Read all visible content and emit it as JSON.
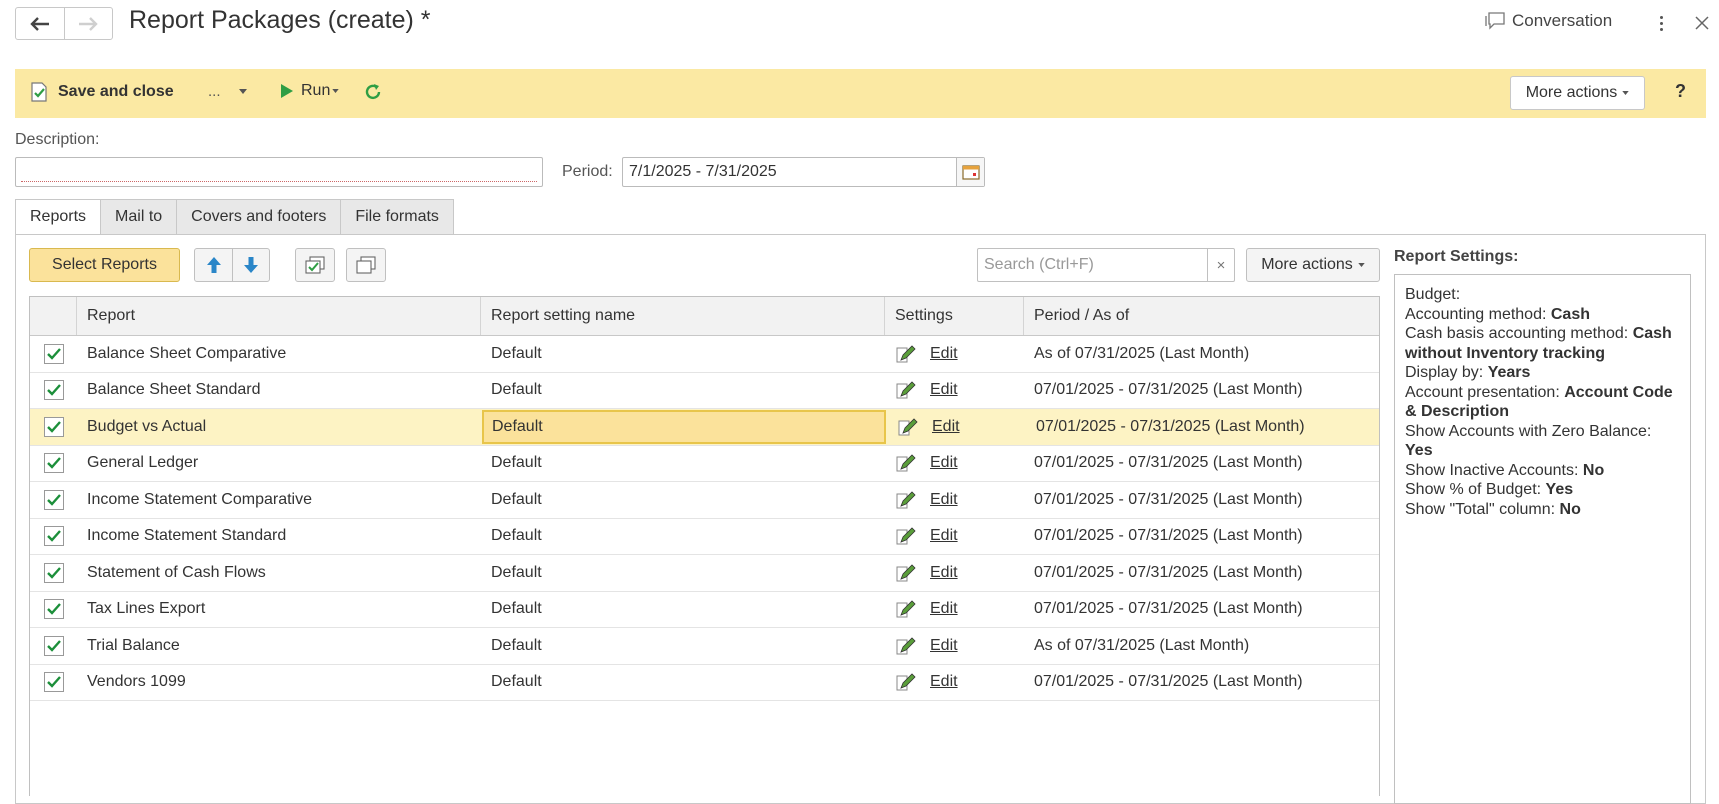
{
  "window": {
    "title": "Report Packages (create) *",
    "conversation_label": "Conversation"
  },
  "toolbar": {
    "save_close_label": "Save and close",
    "more_dd_label": "...",
    "run_label": "Run",
    "more_actions_label": "More actions",
    "help_label": "?"
  },
  "form": {
    "description_label": "Description:",
    "description_value": "",
    "period_label": "Period:",
    "period_value": "7/1/2025 - 7/31/2025"
  },
  "tabs": [
    {
      "label": "Reports",
      "active": true
    },
    {
      "label": "Mail to"
    },
    {
      "label": "Covers and footers"
    },
    {
      "label": "File formats"
    }
  ],
  "reports_toolbar": {
    "select_reports_label": "Select Reports",
    "search_placeholder": "Search (Ctrl+F)",
    "search_clear": "×",
    "more_actions_label": "More actions"
  },
  "grid": {
    "columns": [
      "Report",
      "Report setting name",
      "Settings",
      "Period / As of"
    ],
    "edit_label": "Edit",
    "rows": [
      {
        "report": "Balance Sheet Comparative",
        "setting": "Default",
        "period": "As of 07/31/2025 (Last Month)"
      },
      {
        "report": "Balance Sheet Standard",
        "setting": "Default",
        "period": "07/01/2025 - 07/31/2025 (Last Month)"
      },
      {
        "report": "Budget vs Actual",
        "setting": "Default",
        "period": "07/01/2025 - 07/31/2025 (Last Month)"
      },
      {
        "report": "General Ledger",
        "setting": "Default",
        "period": "07/01/2025 - 07/31/2025 (Last Month)"
      },
      {
        "report": "Income Statement Comparative",
        "setting": "Default",
        "period": "07/01/2025 - 07/31/2025 (Last Month)"
      },
      {
        "report": "Income Statement Standard",
        "setting": "Default",
        "period": "07/01/2025 - 07/31/2025 (Last Month)"
      },
      {
        "report": "Statement of Cash Flows",
        "setting": "Default",
        "period": "07/01/2025 - 07/31/2025 (Last Month)"
      },
      {
        "report": "Tax Lines Export",
        "setting": "Default",
        "period": "07/01/2025 - 07/31/2025 (Last Month)"
      },
      {
        "report": "Trial Balance",
        "setting": "Default",
        "period": "As of 07/31/2025 (Last Month)"
      },
      {
        "report": "Vendors 1099",
        "setting": "Default",
        "period": "07/01/2025 - 07/31/2025 (Last Month)"
      }
    ]
  },
  "report_settings": {
    "title": "Report Settings:",
    "lines": [
      {
        "label": "Budget:",
        "value": ""
      },
      {
        "label": "Accounting method:",
        "value": "Cash"
      },
      {
        "label": "Cash basis accounting method:",
        "value": "Cash without Inventory tracking"
      },
      {
        "label": "Display by:",
        "value": "Years"
      },
      {
        "label": "Account presentation:",
        "value": "Account Code & Description"
      },
      {
        "label": "Show Accounts with Zero Balance:",
        "value": "Yes"
      },
      {
        "label": "Show Inactive Accounts:",
        "value": "No"
      },
      {
        "label": "Show % of Budget:",
        "value": "Yes"
      },
      {
        "label": "Show \"Total\" column:",
        "value": "No"
      }
    ]
  },
  "icons": {
    "back": "arrow-left-icon",
    "forward": "arrow-right-icon",
    "conversation": "speech-bubble-icon",
    "kebab": "kebab-menu-icon",
    "close": "close-icon",
    "save": "document-check-icon",
    "run": "play-icon",
    "refresh": "refresh-icon",
    "calendar": "calendar-icon",
    "up": "arrow-up-icon",
    "down": "arrow-down-icon",
    "check_all": "check-all-icon",
    "uncheck_all": "uncheck-all-icon",
    "edit": "pencil-edit-icon"
  },
  "colors": {
    "toolbar_bg": "#fbe9a3",
    "selected_row": "#fdf3c4",
    "accent_green": "#2f9e44",
    "accent_blue": "#2a86c8"
  }
}
